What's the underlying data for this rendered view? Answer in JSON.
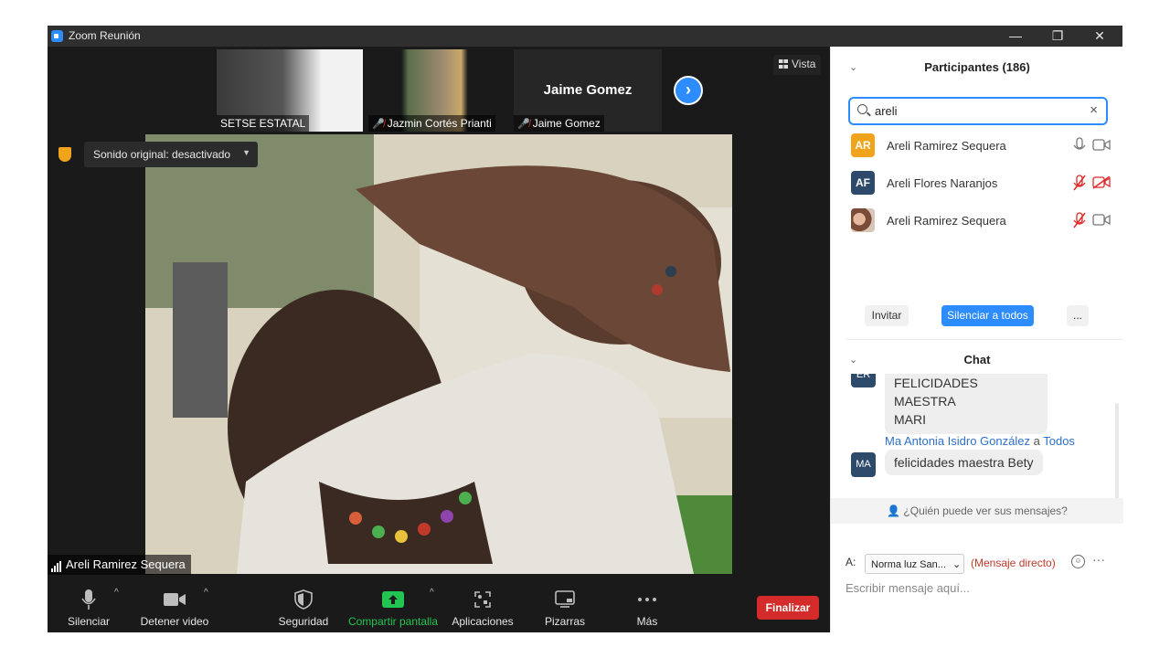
{
  "window": {
    "title": "Zoom Reunión",
    "controls": {
      "minimize": "—",
      "restore": "❐",
      "close": "✕"
    }
  },
  "meeting": {
    "thumbnails": [
      {
        "name": "SETSE ESTATAL",
        "muted": false
      },
      {
        "name": "Jazmin Cortés Prianti",
        "muted": true
      },
      {
        "name": "Jaime Gomez",
        "muted": true,
        "big_label": "Jaime Gomez"
      }
    ],
    "view_button": "Vista",
    "original_sound": "Sonido original: desactivado",
    "speaker_name": "Areli Ramirez Sequera"
  },
  "toolbar": {
    "mute": "Silenciar",
    "video": "Detener video",
    "security": "Seguridad",
    "share": "Compartir pantalla",
    "apps": "Aplicaciones",
    "whiteboards": "Pizarras",
    "more": "Más",
    "end": "Finalizar"
  },
  "participants": {
    "header": "Participantes (186)",
    "search_value": "areli",
    "list": [
      {
        "initials": "AR",
        "name": "Areli Ramirez Sequera",
        "avatar_color": "#f0a41b",
        "mic_muted": false,
        "cam_off": false
      },
      {
        "initials": "AF",
        "name": "Areli Flores Naranjos",
        "avatar_color": "#2e4a6a",
        "mic_muted": true,
        "cam_off": true
      },
      {
        "initials": "",
        "name": "Areli Ramirez Sequera",
        "avatar_color": "#c98a6a",
        "mic_muted": true,
        "cam_off": false
      }
    ],
    "invite": "Invitar",
    "mute_all": "Silenciar a todos",
    "more": "..."
  },
  "chat": {
    "header": "Chat",
    "messages": [
      {
        "initials": "ER",
        "sender": "",
        "to": "",
        "text_line1": "FELICIDADES MAESTRA",
        "text_line2": "MARI"
      },
      {
        "initials": "MA",
        "sender": "Ma Antonia Isidro González",
        "to_word": "a",
        "to": "Todos",
        "text_line1": "felicidades maestra Bety"
      }
    ],
    "who_can_see": "¿Quién puede ver sus mensajes?",
    "to_label": "A:",
    "recipient": "Norma luz San...",
    "direct_label": "(Mensaje directo)",
    "placeholder": "Escribir mensaje aquí..."
  }
}
